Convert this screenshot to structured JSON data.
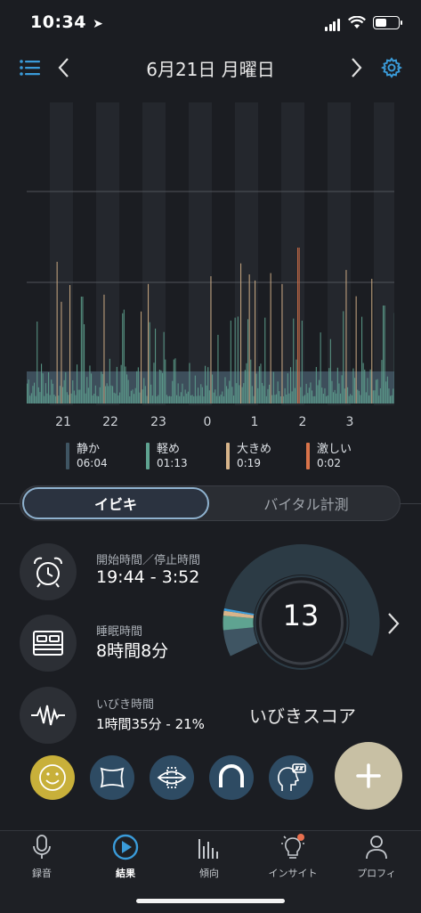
{
  "status_bar": {
    "time": "10:34"
  },
  "header": {
    "title": "6月21日 月曜日"
  },
  "chart_data": {
    "type": "bar",
    "x_ticks": [
      "21",
      "22",
      "23",
      "0",
      "1",
      "2",
      "3"
    ],
    "legend": [
      {
        "label": "静か",
        "value": "06:04",
        "color": "#3f5563"
      },
      {
        "label": "軽め",
        "value": "01:13",
        "color": "#5fa391"
      },
      {
        "label": "大きめ",
        "value": "0:19",
        "color": "#d7b48a"
      },
      {
        "label": "激しい",
        "value": "0:02",
        "color": "#d9734a"
      }
    ]
  },
  "tabs_segment": {
    "active": "イビキ",
    "inactive": "バイタル計測"
  },
  "stats": {
    "time_label": "開始時間／停止時間",
    "time_value": "19:44 - 3:52",
    "sleep_label": "睡眠時間",
    "sleep_value": "8時間8分",
    "snore_label": "いびき時間",
    "snore_value": "1時間35分 - 21%"
  },
  "score": {
    "value": "13",
    "label": "いびきスコア",
    "fractions": {
      "quiet": 0.72,
      "light": 0.19,
      "loud": 0.06,
      "epic": 0.03
    }
  },
  "tabbar": {
    "items": [
      {
        "label": "録音",
        "icon": "microphone-icon"
      },
      {
        "label": "結果",
        "icon": "play-circle-icon"
      },
      {
        "label": "傾向",
        "icon": "bars-icon"
      },
      {
        "label": "インサイト",
        "icon": "bulb-icon"
      },
      {
        "label": "プロフィ",
        "icon": "person-icon"
      }
    ]
  },
  "colors": {
    "accent": "#3a9bd9",
    "quiet": "#3f5563",
    "light": "#5fa391",
    "loud": "#d7b48a",
    "epic": "#d9734a",
    "smiley": "#c8b03a"
  }
}
